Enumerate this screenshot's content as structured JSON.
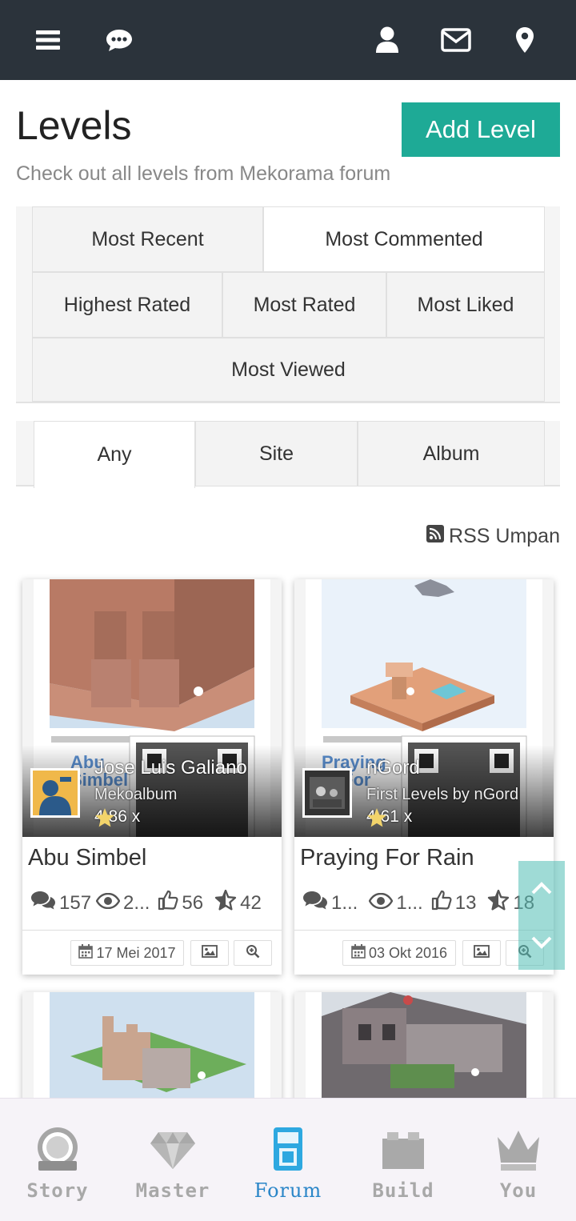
{
  "header": {
    "icons": [
      "menu-icon",
      "chat-icon",
      "user-icon",
      "mail-icon",
      "location-icon"
    ]
  },
  "page": {
    "title": "Levels",
    "add_button": "Add Level",
    "subtitle": "Check out all levels from Mekorama forum"
  },
  "sort_tabs": [
    "Most Recent",
    "Most Commented",
    "Highest Rated",
    "Most Rated",
    "Most Liked",
    "Most Viewed"
  ],
  "sort_active": "Most Commented",
  "filter_tabs": [
    "Any",
    "Site",
    "Album"
  ],
  "filter_active": "Any",
  "rss_label": "RSS Umpan",
  "levels": [
    {
      "title": "Abu Simbel",
      "author": "Jose Luis Galiano",
      "album": "Mekoalbum",
      "rating": "4.86 x",
      "comments": "157",
      "views": "2...",
      "likes": "56",
      "rates": "42",
      "date": "17 Mei 2017"
    },
    {
      "title": "Praying For Rain",
      "author": "nGord",
      "album": "First Levels by nGord",
      "rating": "4.61 x",
      "comments": "1...",
      "views": "1...",
      "likes": "13",
      "rates": "18",
      "date": "03 Okt 2016"
    }
  ],
  "bottom_nav": [
    {
      "label": "Story",
      "icon": "story-icon"
    },
    {
      "label": "Master",
      "icon": "diamond-icon"
    },
    {
      "label": "Forum",
      "icon": "phone-icon"
    },
    {
      "label": "Build",
      "icon": "brick-icon"
    },
    {
      "label": "You",
      "icon": "crown-icon"
    }
  ],
  "bottom_active": "Forum",
  "colors": {
    "header_bg": "#2b333b",
    "accent": "#1eaa96",
    "active_nav": "#2b86c8"
  }
}
